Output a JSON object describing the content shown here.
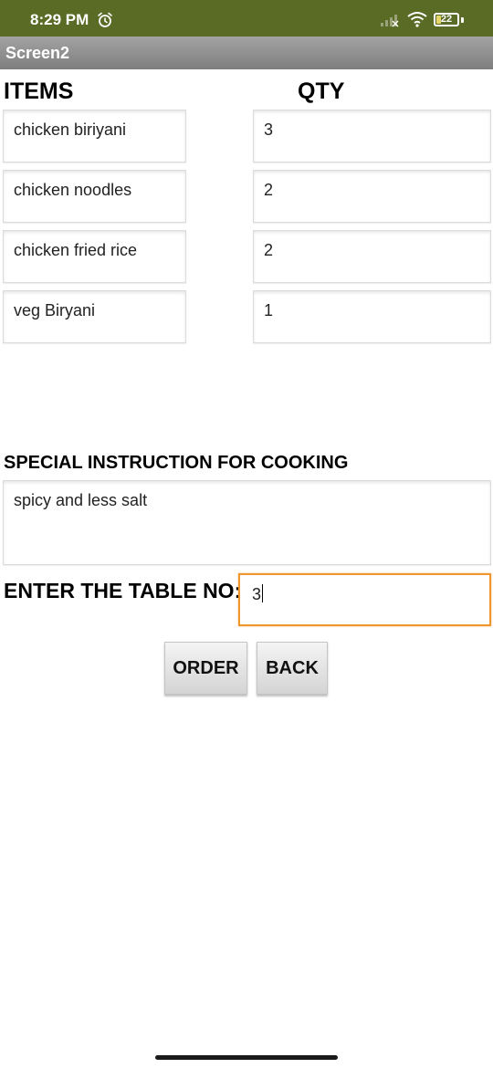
{
  "status_bar": {
    "time": "8:29 PM",
    "battery_level": "22",
    "battery_fraction": 0.22,
    "icons": [
      "alarm-icon",
      "signal-icon",
      "wifi-icon",
      "battery-icon"
    ]
  },
  "title_bar": {
    "title": "Screen2"
  },
  "headers": {
    "items": "ITEMS",
    "qty": "QTY"
  },
  "rows": [
    {
      "item": "chicken biriyani",
      "qty": "3"
    },
    {
      "item": "chicken noodles",
      "qty": "2"
    },
    {
      "item": "chicken fried rice",
      "qty": "2"
    },
    {
      "item": "veg Biryani",
      "qty": "1"
    }
  ],
  "special": {
    "label": "SPECIAL INSTRUCTION FOR COOKING",
    "value": "spicy and less salt"
  },
  "table": {
    "label": "ENTER THE TABLE NO:",
    "value": "3"
  },
  "buttons": {
    "order": "ORDER",
    "back": "BACK"
  },
  "colors": {
    "status_bar": "#5a6b26",
    "title_bar": "#8f8f8f",
    "focus_border": "#f0962c"
  }
}
